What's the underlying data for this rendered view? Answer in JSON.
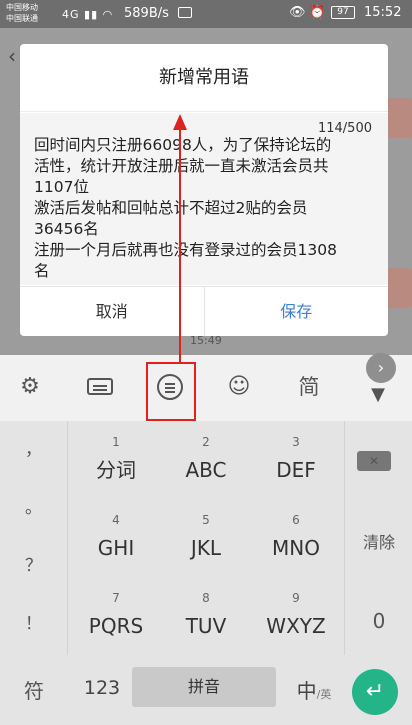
{
  "status_bar": {
    "carrier_1": "中国移动",
    "carrier_2": "中国联通",
    "network": "4G",
    "speed": "589B/s",
    "battery": "97",
    "time": "15:52"
  },
  "background": {
    "timestamp": "15:49"
  },
  "dialog": {
    "title": "新增常用语",
    "counter": "114/500",
    "content": "回时间内只注册66098人，为了保持论坛的\n活性，统计开放注册后就一直未激活会员共\n1107位\n激活后发帖和回帖总计不超过2贴的会员\n36456名\n注册一个月后就再也没有登录过的会员1308\n名",
    "cancel_label": "取消",
    "save_label": "保存"
  },
  "toolbar": {
    "settings_icon": "gear-icon",
    "keyboard_icon": "keyboard-icon",
    "phrases_icon": "phrase-list-icon",
    "emoji_icon": "emoji-icon",
    "simplified_label": "简",
    "collapse_icon": "chevron-down-icon",
    "expand_icon": "chevron-right-icon"
  },
  "keyboard": {
    "punctuation": [
      "，",
      "。",
      "？",
      "！"
    ],
    "keys": [
      {
        "num": "1",
        "label": "分词"
      },
      {
        "num": "2",
        "label": "ABC"
      },
      {
        "num": "3",
        "label": "DEF"
      },
      {
        "num": "4",
        "label": "GHI"
      },
      {
        "num": "5",
        "label": "JKL"
      },
      {
        "num": "6",
        "label": "MNO"
      },
      {
        "num": "7",
        "label": "PQRS"
      },
      {
        "num": "8",
        "label": "TUV"
      },
      {
        "num": "9",
        "label": "WXYZ"
      }
    ],
    "clear_label": "清除",
    "zero_label": "0",
    "symbol_label": "符",
    "numbers_label": "123",
    "space_label": "拼音",
    "lang_main": "中",
    "lang_alt": "英",
    "accent_color": "#23b487"
  },
  "annotation_color": "#dd2222"
}
